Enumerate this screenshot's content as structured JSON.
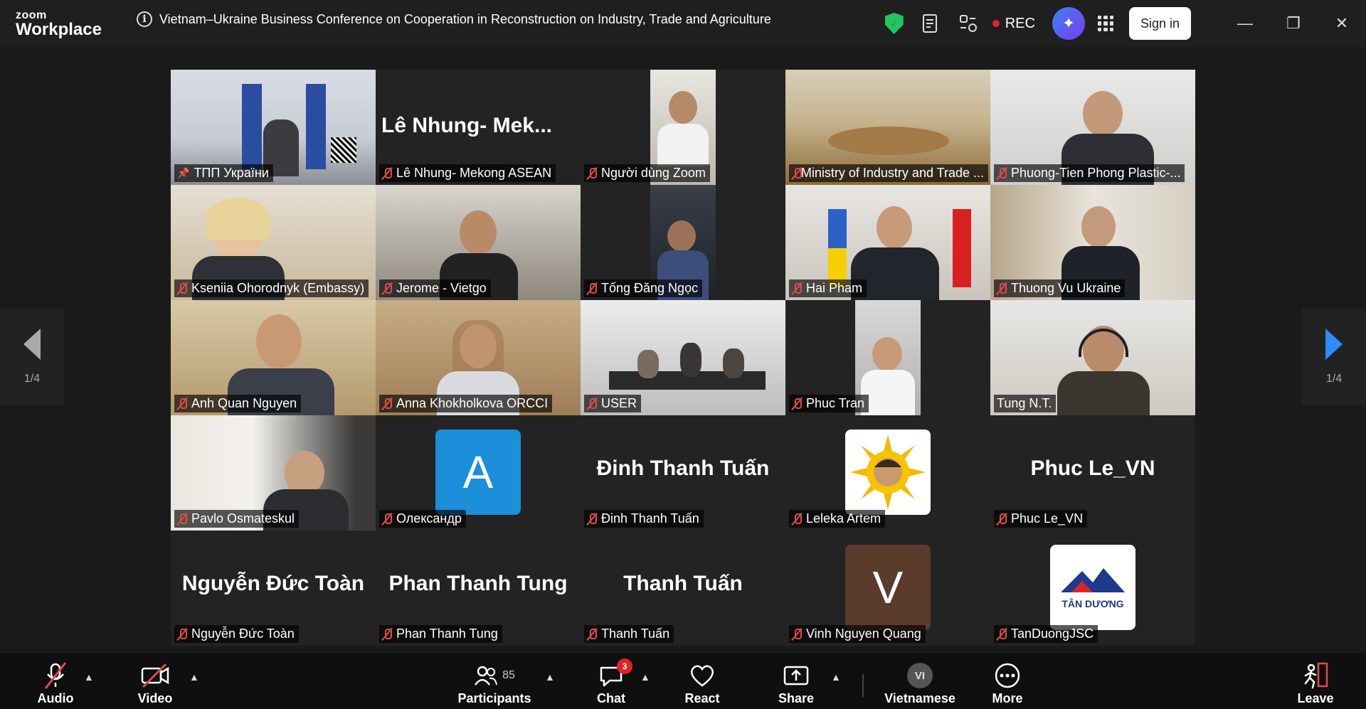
{
  "app": {
    "logo_top": "zoom",
    "logo_bottom": "Workplace"
  },
  "meeting": {
    "title": "Vietnam–Ukraine Business Conference on Cooperation in Reconstruction on Industry, Trade and Agriculture"
  },
  "topbar": {
    "rec_label": "REC",
    "signin_label": "Sign in"
  },
  "paging": {
    "left": "1/4",
    "right": "1/4"
  },
  "tiles": [
    {
      "label": "ТПП України",
      "pinned": true
    },
    {
      "label": "Lê Nhung- Mekong ASEAN",
      "bigname": "Lê Nhung- Mek..."
    },
    {
      "label": "Người dùng Zoom"
    },
    {
      "label": "Ministry of Industry and Trade ..."
    },
    {
      "label": "Phuong-Tien Phong Plastic-..."
    },
    {
      "label": "Kseniia Ohorodnyk (Embassy)"
    },
    {
      "label": "Jerome - Vietgo"
    },
    {
      "label": "Tống Đăng Ngọc"
    },
    {
      "label": "Hai Pham"
    },
    {
      "label": "Thuong Vu Ukraine"
    },
    {
      "label": "Anh Quan Nguyen"
    },
    {
      "label": "Anna Khokholkova ORCCI"
    },
    {
      "label": "USER"
    },
    {
      "label": "Phuc Tran"
    },
    {
      "label": "Tung N.T."
    },
    {
      "label": "Pavlo Osmateskul"
    },
    {
      "label": "Олександр",
      "avatar": "A"
    },
    {
      "label": "Đinh Thanh Tuấn",
      "bigname": "Đinh Thanh Tuấn"
    },
    {
      "label": "Leleka Artem"
    },
    {
      "label": "Phuc Le_VN",
      "bigname": "Phuc Le_VN"
    },
    {
      "label": "Nguyễn Đức Toàn",
      "bigname": "Nguyễn Đức Toàn"
    },
    {
      "label": "Phan Thanh Tung",
      "bigname": "Phan Thanh Tung"
    },
    {
      "label": "Thanh Tuấn",
      "bigname": "Thanh Tuấn"
    },
    {
      "label": "Vinh Nguyen Quang",
      "avatar": "V"
    },
    {
      "label": "TanDuongJSC",
      "logo_text": "TÂN DƯƠNG"
    }
  ],
  "toolbar": {
    "audio": "Audio",
    "video": "Video",
    "participants": "Participants",
    "participants_count": "85",
    "chat": "Chat",
    "chat_badge": "3",
    "react": "React",
    "share": "Share",
    "language": "Vietnamese",
    "language_code": "VI",
    "more": "More",
    "leave": "Leave"
  },
  "colors": {
    "active_border": "#2ecc71",
    "mute_red": "#e24a4a",
    "accent_blue": "#2d8cff"
  }
}
